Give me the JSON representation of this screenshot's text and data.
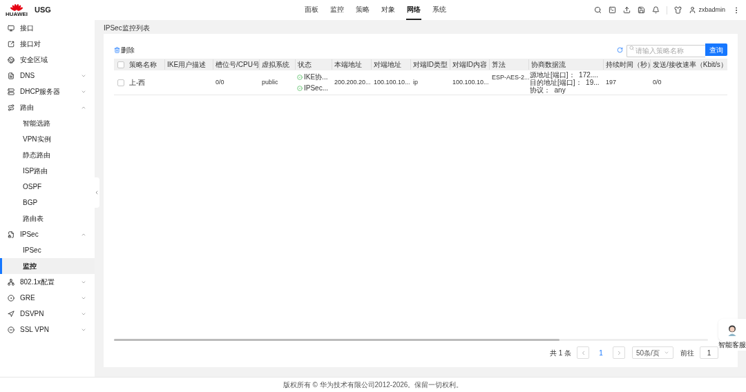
{
  "header": {
    "brand": "HUAWEI",
    "product": "USG",
    "user": "zxbadmin"
  },
  "nav": [
    {
      "label": "面板",
      "selected": false
    },
    {
      "label": "监控",
      "selected": false
    },
    {
      "label": "策略",
      "selected": false
    },
    {
      "label": "对象",
      "selected": false
    },
    {
      "label": "网络",
      "selected": true
    },
    {
      "label": "系统",
      "selected": false
    }
  ],
  "sidebar": {
    "items": [
      {
        "label": "接口",
        "selected": false
      },
      {
        "label": "接口对",
        "selected": false
      },
      {
        "label": "安全区域",
        "selected": false
      },
      {
        "label": "DNS",
        "expanded": false,
        "selected": false
      },
      {
        "label": "DHCP服务器",
        "expanded": false,
        "selected": false
      },
      {
        "label": "路由",
        "expanded": true,
        "selected": false,
        "children": [
          {
            "label": "智能选路",
            "selected": false
          },
          {
            "label": "VPN实例",
            "selected": false
          },
          {
            "label": "静态路由",
            "selected": false
          },
          {
            "label": "ISP路由",
            "selected": false
          },
          {
            "label": "OSPF",
            "selected": false
          },
          {
            "label": "BGP",
            "selected": false
          },
          {
            "label": "路由表",
            "selected": false
          }
        ]
      },
      {
        "label": "IPSec",
        "expanded": true,
        "selected": false,
        "children": [
          {
            "label": "IPSec",
            "selected": false
          },
          {
            "label": "监控",
            "selected": true
          }
        ]
      },
      {
        "label": "802.1x配置",
        "expanded": false,
        "selected": false
      },
      {
        "label": "GRE",
        "expanded": false,
        "selected": false
      },
      {
        "label": "DSVPN",
        "expanded": false,
        "selected": false
      },
      {
        "label": "SSL VPN",
        "expanded": false,
        "selected": false
      }
    ]
  },
  "page_title": "IPSec监控列表",
  "toolbar": {
    "delete": "删除",
    "search": {
      "placeholder": "请输入策略名称"
    },
    "query": "查询"
  },
  "table": {
    "columns": [
      "策略名称",
      "IKE用户描述",
      "槽位号/CPU号",
      "虚拟系统",
      "状态",
      "本端地址",
      "对端地址",
      "对端ID类型",
      "对端ID内容",
      "算法",
      "协商数据流",
      "持续时间（秒）",
      "发送/接收速率（Kbit/s）"
    ],
    "header_checked": false,
    "rows": [
      {
        "checked": false,
        "name": "上-西",
        "slot": "0/0",
        "vsys": "public",
        "status": [
          "IKE协...",
          "IPSec..."
        ],
        "local": "200.200.20...",
        "peer": "100.100.10...",
        "peer_id_type": "ip",
        "peer_id": "100.100.10...",
        "algorithm": "ESP-AES-2...",
        "flow": [
          "源地址[端口]：  172....",
          "目的地址[端口]：  19...",
          "协议：  any"
        ],
        "duration": "197",
        "rate": "0/0"
      }
    ]
  },
  "pagination": {
    "total": "共 1 条",
    "pages": [
      {
        "label": "1",
        "selected": true
      }
    ],
    "page_size": "50条/页",
    "goto_label": "前往",
    "goto_value": "1"
  },
  "assistant": {
    "label": "智能客服"
  },
  "footer": "版权所有 © 华为技术有限公司2012-2026。保留一切权利。"
}
